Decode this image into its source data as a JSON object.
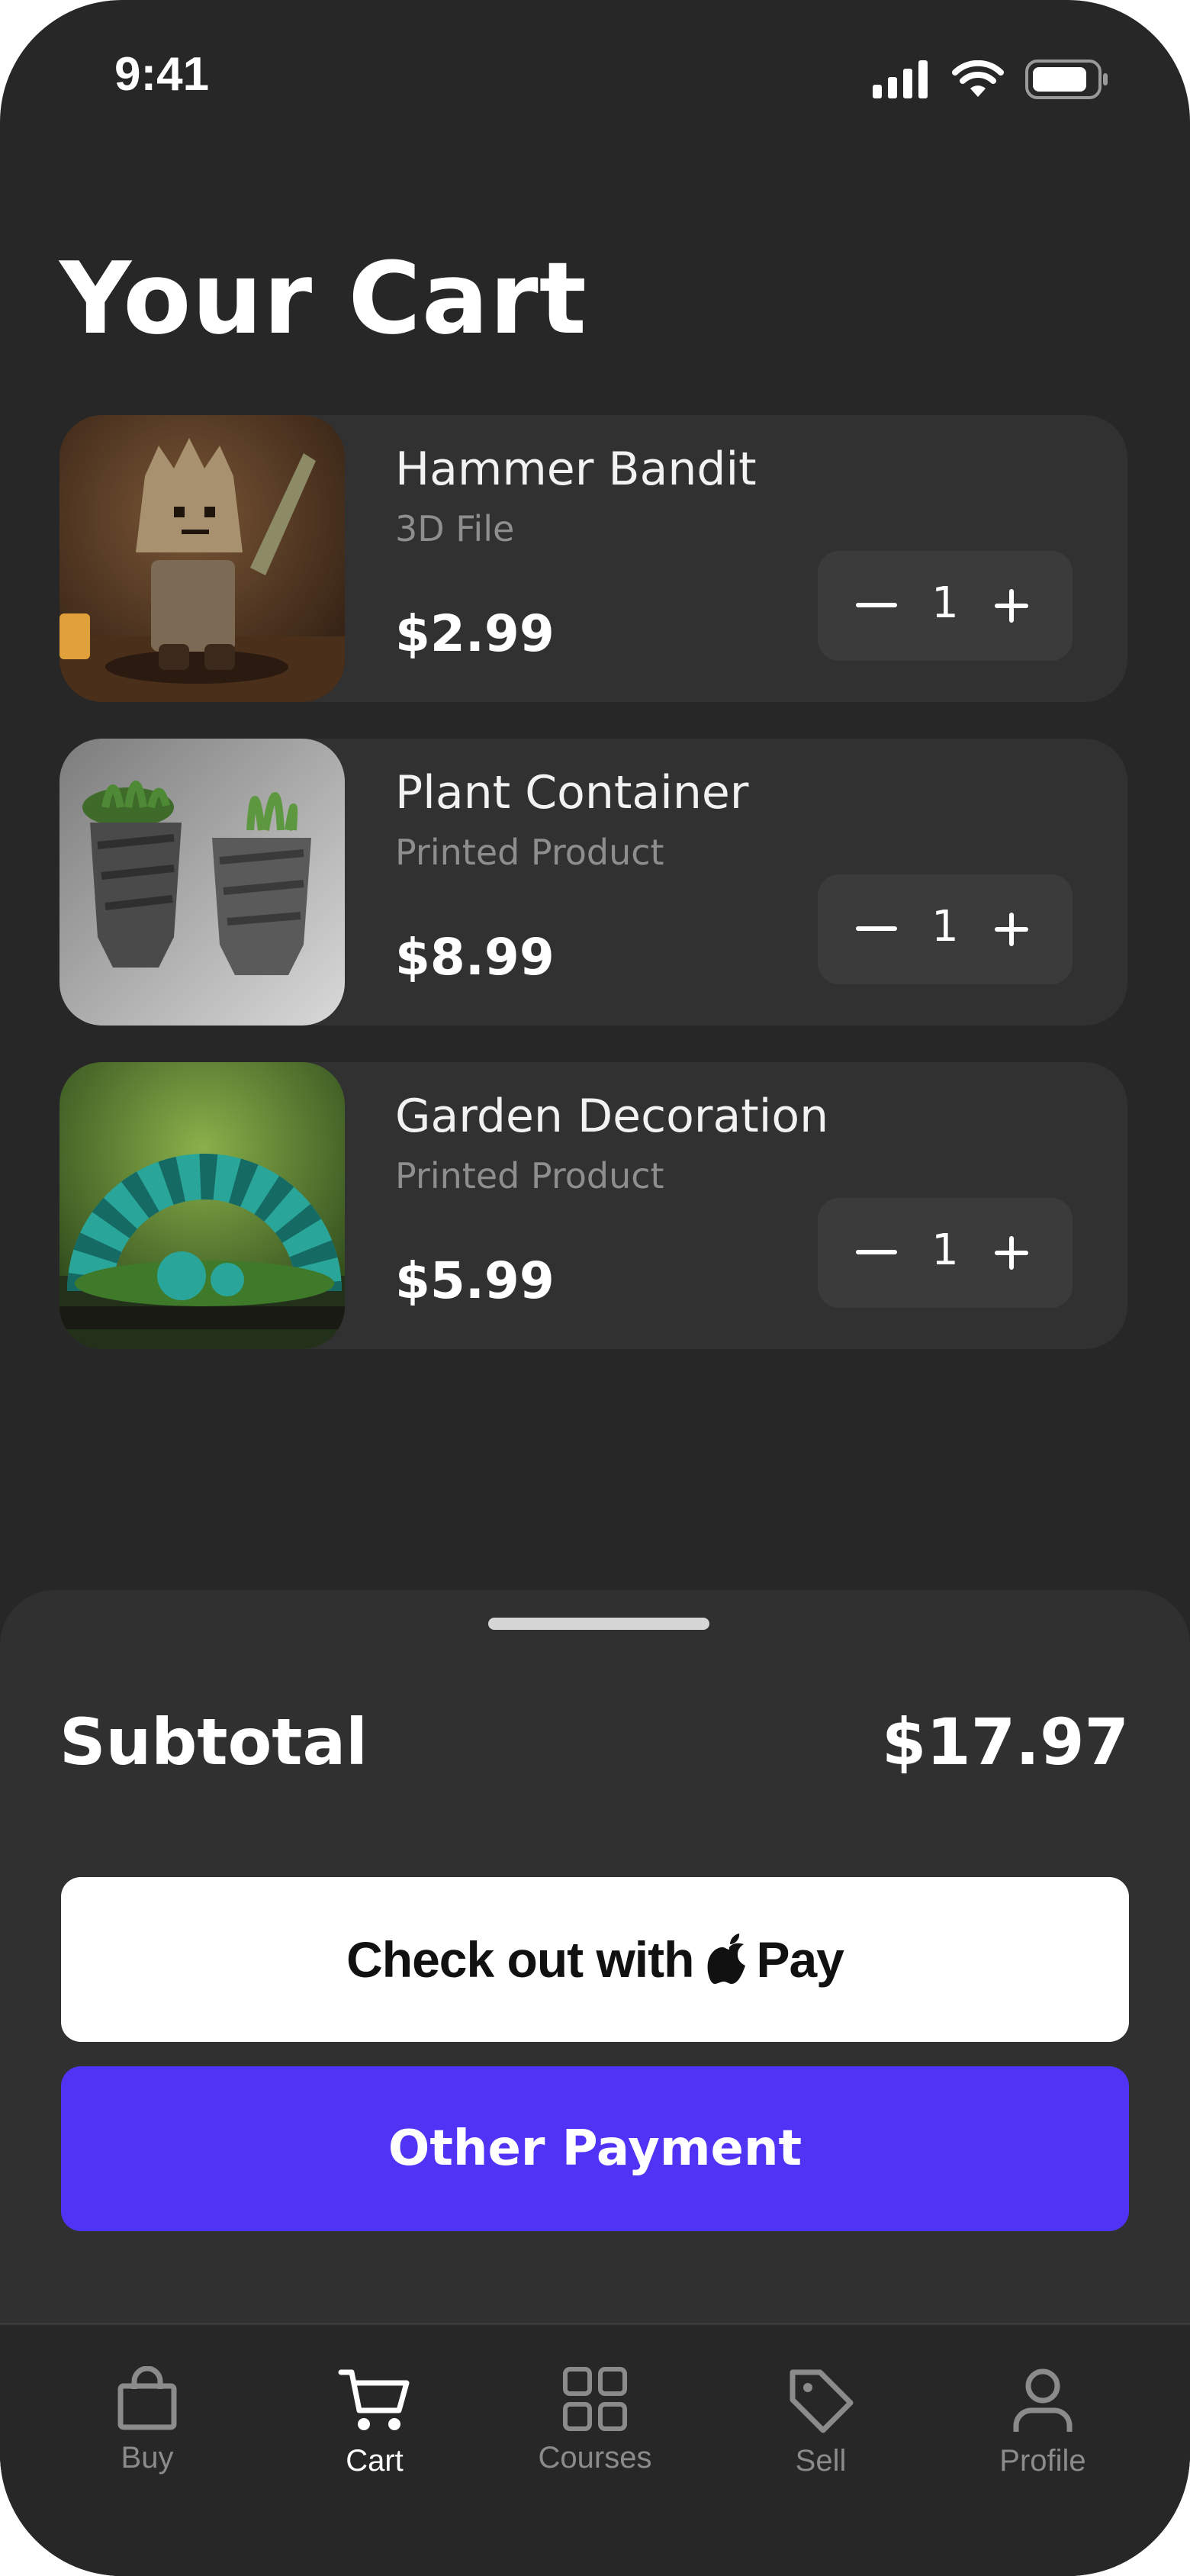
{
  "status_bar": {
    "time": "9:41"
  },
  "page": {
    "title": "Your Cart"
  },
  "cart": {
    "items": [
      {
        "name": "Hammer Bandit",
        "type": "3D File",
        "price": "$2.99",
        "quantity": "1"
      },
      {
        "name": "Plant Container",
        "type": "Printed Product",
        "price": "$8.99",
        "quantity": "1"
      },
      {
        "name": "Garden Decoration",
        "type": "Printed Product",
        "price": "$5.99",
        "quantity": "1"
      }
    ]
  },
  "summary": {
    "subtotal_label": "Subtotal",
    "subtotal_value": "$17.97"
  },
  "buttons": {
    "applepay_prefix": "Check out with",
    "applepay_suffix": "Pay",
    "other_payment": "Other Payment"
  },
  "colors": {
    "background": "#272727",
    "card": "#313131",
    "accent": "#4f34f5"
  },
  "tabbar": {
    "items": [
      {
        "label": "Buy",
        "icon": "shopping-bag-icon"
      },
      {
        "label": "Cart",
        "icon": "cart-icon",
        "active": true
      },
      {
        "label": "Courses",
        "icon": "grid-icon"
      },
      {
        "label": "Sell",
        "icon": "tag-icon"
      },
      {
        "label": "Profile",
        "icon": "person-icon"
      }
    ]
  }
}
